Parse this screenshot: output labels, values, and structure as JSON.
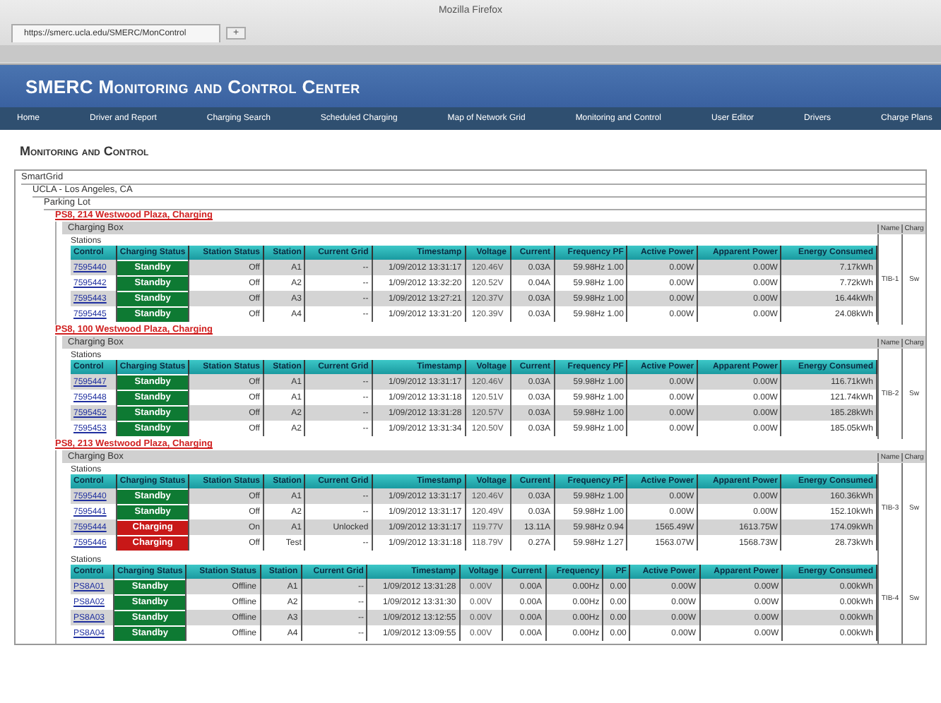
{
  "browser": {
    "window_title": "Mozilla Firefox",
    "tab_title": "https://smerc.ucla.edu/SMERC/MonControl",
    "new_tab": "+"
  },
  "header": {
    "title": "SMERC Monitoring and Control Center"
  },
  "nav": [
    "Home",
    "Driver and Report",
    "Charging Search",
    "Scheduled Charging",
    "Map of Network Grid",
    "Monitoring and Control",
    "User Editor",
    "Drivers",
    "Charge Plans"
  ],
  "page_title": "Monitoring and Control",
  "network": "SmartGrid",
  "site": "UCLA - Los Angeles, CA",
  "lot": "Parking Lot",
  "structures": [
    {
      "name": "PS8, 214 Westwood Plaza, Charging",
      "box_label": "Charging Box",
      "side_headers": [
        "Name",
        "Charg"
      ],
      "groups": [
        {
          "label": "Stations",
          "side_values": [
            "TIB-1",
            "Sw"
          ],
          "columns": [
            "Control",
            "Charging Status",
            "Station Status",
            "Station",
            "Current Grid",
            "Timestamp",
            "Voltage",
            "Current",
            "Frequency PF",
            "Active Power",
            "Apparent Power",
            "Energy Consumed"
          ],
          "rows": [
            {
              "charging": false,
              "cells": [
                "7595440",
                "Standby",
                "Off",
                "A1",
                "--",
                "1/09/2012 13:31:17",
                "120.46V",
                "0.03A",
                "59.98Hz 1.00",
                "0.00W",
                "0.00W",
                "7.17kWh"
              ]
            },
            {
              "charging": false,
              "cells": [
                "7595442",
                "Standby",
                "Off",
                "A2",
                "--",
                "1/09/2012 13:32:20",
                "120.52V",
                "0.04A",
                "59.98Hz 1.00",
                "0.00W",
                "0.00W",
                "7.72kWh"
              ]
            },
            {
              "charging": false,
              "cells": [
                "7595443",
                "Standby",
                "Off",
                "A3",
                "--",
                "1/09/2012 13:27:21",
                "120.37V",
                "0.03A",
                "59.98Hz 1.00",
                "0.00W",
                "0.00W",
                "16.44kWh"
              ]
            },
            {
              "charging": false,
              "cells": [
                "7595445",
                "Standby",
                "Off",
                "A4",
                "--",
                "1/09/2012 13:31:20",
                "120.39V",
                "0.03A",
                "59.98Hz 1.00",
                "0.00W",
                "0.00W",
                "24.08kWh"
              ]
            }
          ]
        }
      ]
    },
    {
      "name": "PS8, 100 Westwood Plaza, Charging",
      "box_label": "Charging Box",
      "side_headers": [
        "Name",
        "Charg"
      ],
      "groups": [
        {
          "label": "Stations",
          "side_values": [
            "TIB-2",
            "Sw"
          ],
          "columns": [
            "Control",
            "Charging Status",
            "Station Status",
            "Station",
            "Current Grid",
            "Timestamp",
            "Voltage",
            "Current",
            "Frequency PF",
            "Active Power",
            "Apparent Power",
            "Energy Consumed"
          ],
          "rows": [
            {
              "charging": false,
              "cells": [
                "7595447",
                "Standby",
                "Off",
                "A1",
                "--",
                "1/09/2012 13:31:17",
                "120.46V",
                "0.03A",
                "59.98Hz 1.00",
                "0.00W",
                "0.00W",
                "116.71kWh"
              ]
            },
            {
              "charging": false,
              "cells": [
                "7595448",
                "Standby",
                "Off",
                "A1",
                "--",
                "1/09/2012 13:31:18",
                "120.51V",
                "0.03A",
                "59.98Hz 1.00",
                "0.00W",
                "0.00W",
                "121.74kWh"
              ]
            },
            {
              "charging": false,
              "cells": [
                "7595452",
                "Standby",
                "Off",
                "A2",
                "--",
                "1/09/2012 13:31:28",
                "120.57V",
                "0.03A",
                "59.98Hz 1.00",
                "0.00W",
                "0.00W",
                "185.28kWh"
              ]
            },
            {
              "charging": false,
              "cells": [
                "7595453",
                "Standby",
                "Off",
                "A2",
                "--",
                "1/09/2012 13:31:34",
                "120.50V",
                "0.03A",
                "59.98Hz 1.00",
                "0.00W",
                "0.00W",
                "185.05kWh"
              ]
            }
          ]
        }
      ]
    },
    {
      "name": "PS8, 213 Westwood Plaza, Charging",
      "box_label": "Charging Box",
      "side_headers": [
        "Name",
        "Charg"
      ],
      "groups": [
        {
          "label": "Stations",
          "side_values": [
            "TIB-3",
            "Sw"
          ],
          "columns": [
            "Control",
            "Charging Status",
            "Station Status",
            "Station",
            "Current Grid",
            "Timestamp",
            "Voltage",
            "Current",
            "Frequency PF",
            "Active Power",
            "Apparent Power",
            "Energy Consumed"
          ],
          "rows": [
            {
              "charging": false,
              "cells": [
                "7595440",
                "Standby",
                "Off",
                "A1",
                "--",
                "1/09/2012 13:31:17",
                "120.46V",
                "0.03A",
                "59.98Hz 1.00",
                "0.00W",
                "0.00W",
                "160.36kWh"
              ]
            },
            {
              "charging": false,
              "cells": [
                "7595441",
                "Standby",
                "Off",
                "A2",
                "--",
                "1/09/2012 13:31:17",
                "120.49V",
                "0.03A",
                "59.98Hz 1.00",
                "0.00W",
                "0.00W",
                "152.10kWh"
              ]
            },
            {
              "charging": true,
              "cells": [
                "7595444",
                "Charging",
                "On",
                "A1",
                "Unlocked",
                "1/09/2012 13:31:17",
                "119.77V",
                "13.11A",
                "59.98Hz 0.94",
                "1565.49W",
                "1613.75W",
                "174.09kWh"
              ]
            },
            {
              "charging": true,
              "cells": [
                "7595446",
                "Charging",
                "Off",
                "Test",
                "--",
                "1/09/2012 13:31:18",
                "118.79V",
                "0.27A",
                "59.98Hz 1.27",
                "1563.07W",
                "1568.73W",
                "28.73kWh"
              ]
            }
          ]
        },
        {
          "label": "Stations",
          "side_values": [
            "TIB-4",
            "Sw"
          ],
          "columns": [
            "Control",
            "Charging Status",
            "Station Status",
            "Station",
            "Current Grid",
            "Timestamp",
            "Voltage",
            "Current",
            "Frequency",
            "PF",
            "Active Power",
            "Apparent Power",
            "Energy Consumed"
          ],
          "rows": [
            {
              "charging": false,
              "cells": [
                "PS8A01",
                "Standby",
                "Offline",
                "A1",
                "--",
                "1/09/2012 13:31:28",
                "0.00V",
                "0.00A",
                "0.00Hz",
                "0.00",
                "0.00W",
                "0.00W",
                "0.00kWh"
              ]
            },
            {
              "charging": false,
              "cells": [
                "PS8A02",
                "Standby",
                "Offline",
                "A2",
                "--",
                "1/09/2012 13:31:30",
                "0.00V",
                "0.00A",
                "0.00Hz",
                "0.00",
                "0.00W",
                "0.00W",
                "0.00kWh"
              ]
            },
            {
              "charging": false,
              "cells": [
                "PS8A03",
                "Standby",
                "Offline",
                "A3",
                "--",
                "1/09/2012 13:12:55",
                "0.00V",
                "0.00A",
                "0.00Hz",
                "0.00",
                "0.00W",
                "0.00W",
                "0.00kWh"
              ]
            },
            {
              "charging": false,
              "cells": [
                "PS8A04",
                "Standby",
                "Offline",
                "A4",
                "--",
                "1/09/2012 13:09:55",
                "0.00V",
                "0.00A",
                "0.00Hz",
                "0.00",
                "0.00W",
                "0.00W",
                "0.00kWh"
              ]
            }
          ]
        }
      ]
    }
  ]
}
